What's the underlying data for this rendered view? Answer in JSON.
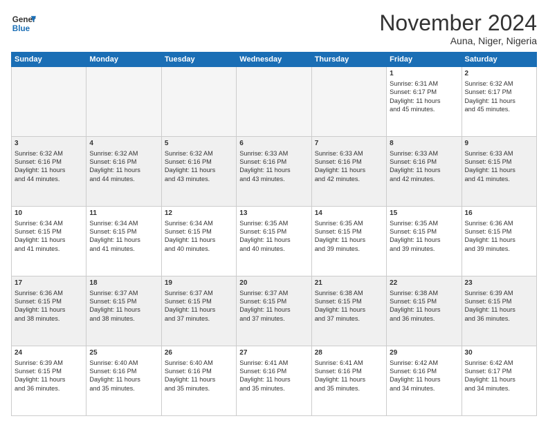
{
  "header": {
    "logo_line1": "General",
    "logo_line2": "Blue",
    "month": "November 2024",
    "location": "Auna, Niger, Nigeria"
  },
  "weekdays": [
    "Sunday",
    "Monday",
    "Tuesday",
    "Wednesday",
    "Thursday",
    "Friday",
    "Saturday"
  ],
  "weeks": [
    [
      {
        "day": "",
        "text": ""
      },
      {
        "day": "",
        "text": ""
      },
      {
        "day": "",
        "text": ""
      },
      {
        "day": "",
        "text": ""
      },
      {
        "day": "",
        "text": ""
      },
      {
        "day": "1",
        "text": "Sunrise: 6:31 AM\nSunset: 6:17 PM\nDaylight: 11 hours\nand 45 minutes."
      },
      {
        "day": "2",
        "text": "Sunrise: 6:32 AM\nSunset: 6:17 PM\nDaylight: 11 hours\nand 45 minutes."
      }
    ],
    [
      {
        "day": "3",
        "text": "Sunrise: 6:32 AM\nSunset: 6:16 PM\nDaylight: 11 hours\nand 44 minutes."
      },
      {
        "day": "4",
        "text": "Sunrise: 6:32 AM\nSunset: 6:16 PM\nDaylight: 11 hours\nand 44 minutes."
      },
      {
        "day": "5",
        "text": "Sunrise: 6:32 AM\nSunset: 6:16 PM\nDaylight: 11 hours\nand 43 minutes."
      },
      {
        "day": "6",
        "text": "Sunrise: 6:33 AM\nSunset: 6:16 PM\nDaylight: 11 hours\nand 43 minutes."
      },
      {
        "day": "7",
        "text": "Sunrise: 6:33 AM\nSunset: 6:16 PM\nDaylight: 11 hours\nand 42 minutes."
      },
      {
        "day": "8",
        "text": "Sunrise: 6:33 AM\nSunset: 6:16 PM\nDaylight: 11 hours\nand 42 minutes."
      },
      {
        "day": "9",
        "text": "Sunrise: 6:33 AM\nSunset: 6:15 PM\nDaylight: 11 hours\nand 41 minutes."
      }
    ],
    [
      {
        "day": "10",
        "text": "Sunrise: 6:34 AM\nSunset: 6:15 PM\nDaylight: 11 hours\nand 41 minutes."
      },
      {
        "day": "11",
        "text": "Sunrise: 6:34 AM\nSunset: 6:15 PM\nDaylight: 11 hours\nand 41 minutes."
      },
      {
        "day": "12",
        "text": "Sunrise: 6:34 AM\nSunset: 6:15 PM\nDaylight: 11 hours\nand 40 minutes."
      },
      {
        "day": "13",
        "text": "Sunrise: 6:35 AM\nSunset: 6:15 PM\nDaylight: 11 hours\nand 40 minutes."
      },
      {
        "day": "14",
        "text": "Sunrise: 6:35 AM\nSunset: 6:15 PM\nDaylight: 11 hours\nand 39 minutes."
      },
      {
        "day": "15",
        "text": "Sunrise: 6:35 AM\nSunset: 6:15 PM\nDaylight: 11 hours\nand 39 minutes."
      },
      {
        "day": "16",
        "text": "Sunrise: 6:36 AM\nSunset: 6:15 PM\nDaylight: 11 hours\nand 39 minutes."
      }
    ],
    [
      {
        "day": "17",
        "text": "Sunrise: 6:36 AM\nSunset: 6:15 PM\nDaylight: 11 hours\nand 38 minutes."
      },
      {
        "day": "18",
        "text": "Sunrise: 6:37 AM\nSunset: 6:15 PM\nDaylight: 11 hours\nand 38 minutes."
      },
      {
        "day": "19",
        "text": "Sunrise: 6:37 AM\nSunset: 6:15 PM\nDaylight: 11 hours\nand 37 minutes."
      },
      {
        "day": "20",
        "text": "Sunrise: 6:37 AM\nSunset: 6:15 PM\nDaylight: 11 hours\nand 37 minutes."
      },
      {
        "day": "21",
        "text": "Sunrise: 6:38 AM\nSunset: 6:15 PM\nDaylight: 11 hours\nand 37 minutes."
      },
      {
        "day": "22",
        "text": "Sunrise: 6:38 AM\nSunset: 6:15 PM\nDaylight: 11 hours\nand 36 minutes."
      },
      {
        "day": "23",
        "text": "Sunrise: 6:39 AM\nSunset: 6:15 PM\nDaylight: 11 hours\nand 36 minutes."
      }
    ],
    [
      {
        "day": "24",
        "text": "Sunrise: 6:39 AM\nSunset: 6:15 PM\nDaylight: 11 hours\nand 36 minutes."
      },
      {
        "day": "25",
        "text": "Sunrise: 6:40 AM\nSunset: 6:16 PM\nDaylight: 11 hours\nand 35 minutes."
      },
      {
        "day": "26",
        "text": "Sunrise: 6:40 AM\nSunset: 6:16 PM\nDaylight: 11 hours\nand 35 minutes."
      },
      {
        "day": "27",
        "text": "Sunrise: 6:41 AM\nSunset: 6:16 PM\nDaylight: 11 hours\nand 35 minutes."
      },
      {
        "day": "28",
        "text": "Sunrise: 6:41 AM\nSunset: 6:16 PM\nDaylight: 11 hours\nand 35 minutes."
      },
      {
        "day": "29",
        "text": "Sunrise: 6:42 AM\nSunset: 6:16 PM\nDaylight: 11 hours\nand 34 minutes."
      },
      {
        "day": "30",
        "text": "Sunrise: 6:42 AM\nSunset: 6:17 PM\nDaylight: 11 hours\nand 34 minutes."
      }
    ]
  ]
}
